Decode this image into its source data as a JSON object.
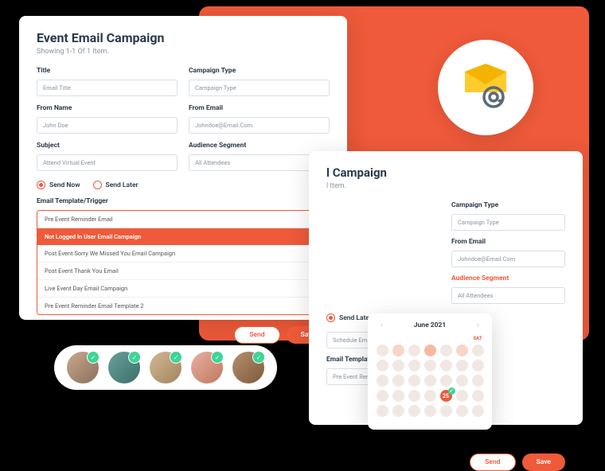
{
  "panel1": {
    "title": "Event Email Campaign",
    "subtitle": "Showing 1-1 Of 1 Item.",
    "fields": {
      "title_label": "Title",
      "title_value": "Email Title",
      "campaign_type_label": "Campaign Type",
      "campaign_type_value": "Campaign Type",
      "from_name_label": "From Name",
      "from_name_value": "John Doe",
      "from_email_label": "From Email",
      "from_email_value": "Johndoe@Email.Com",
      "subject_label": "Subject",
      "subject_value": "Attend Virtual Event",
      "audience_label": "Audience Segment",
      "audience_value": "All Attendees"
    },
    "send_now": "Send Now",
    "send_later": "Send Later",
    "template_label": "Email Template/Trigger",
    "templates": [
      "Pre Event Reminder Email",
      "Not Logged In User Email Campaign",
      "Post Event Sorry We Missed You Email Campaign",
      "Post Event Thank You Email",
      "Live Event Day Email Campaign",
      "Pre Event Reminder Email Template 2"
    ],
    "send": "Send",
    "save": "Save"
  },
  "panel2": {
    "title": "l Campaign",
    "subtitle": "l Item.",
    "fields": {
      "campaign_type_label": "Campaign Type",
      "campaign_type_value": "Campaign Type",
      "from_email_label": "From Email",
      "from_email_value": "Johndoe@Email.Com",
      "audience_label": "Audience Segment",
      "audience_value": "All Attendees"
    },
    "send_later": "Send Later",
    "schedule_value": "Schedule Email",
    "template_label": "Email Template",
    "template_value": "Pre Event Remin",
    "send": "Send",
    "save": "Save"
  },
  "calendar": {
    "month": "June 2021",
    "day_labels": [
      "",
      "",
      "",
      "",
      "",
      "",
      "SAT"
    ],
    "selected_day": "25"
  }
}
